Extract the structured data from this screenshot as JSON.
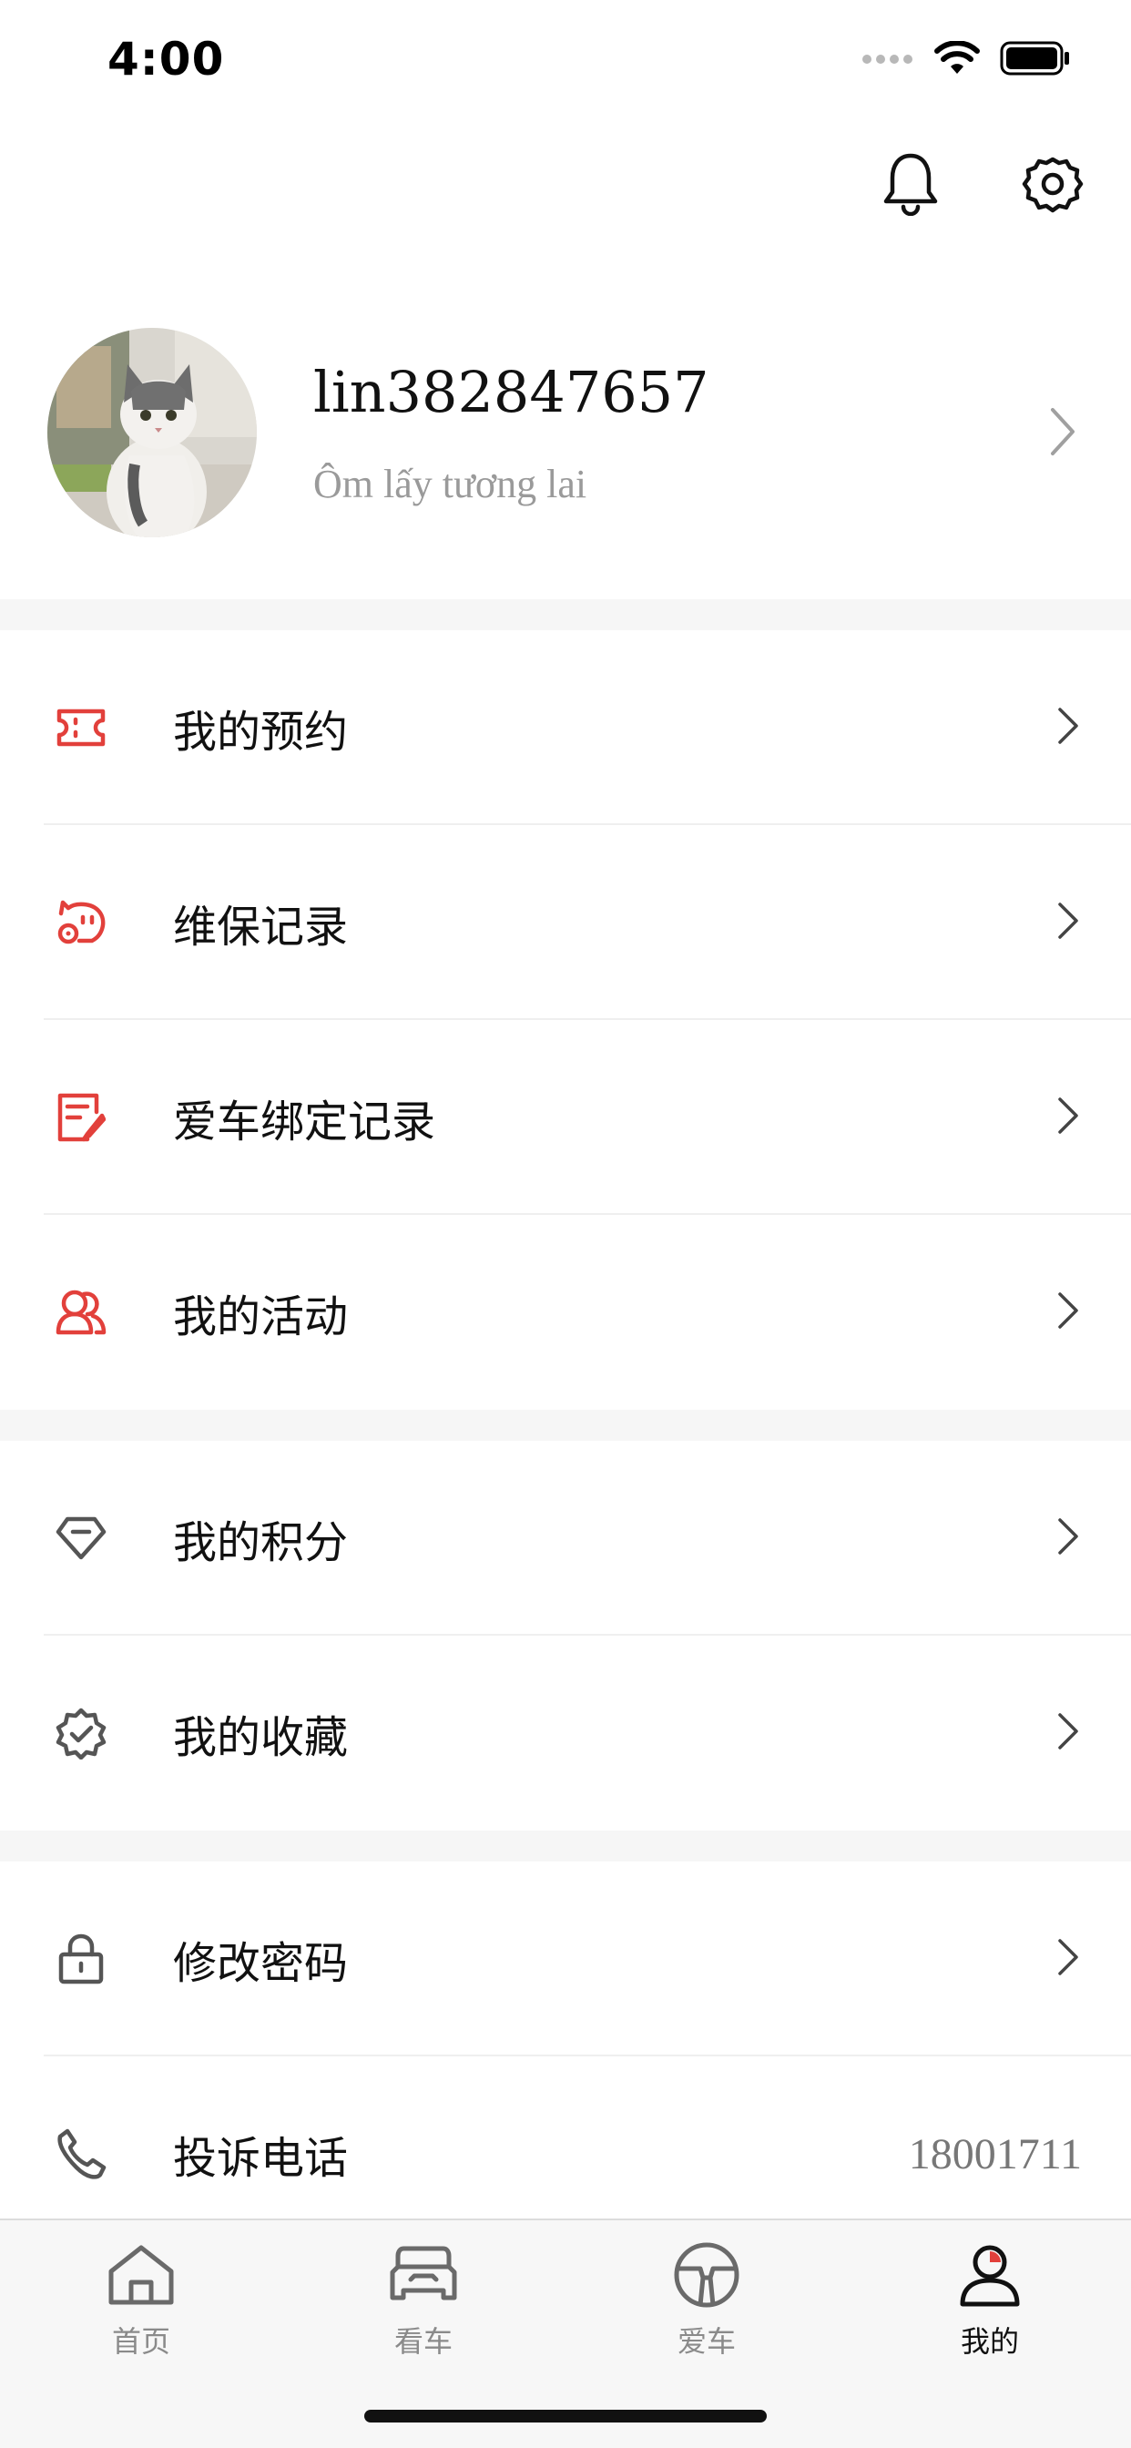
{
  "status_bar": {
    "time": "4:00"
  },
  "header": {
    "icons": [
      "bell-icon",
      "gear-icon"
    ]
  },
  "profile": {
    "username": "lin382847657",
    "signature": "Ôm lấy tương lai"
  },
  "menu_groups": [
    {
      "items": [
        {
          "label": "我的预约",
          "icon": "ticket-icon"
        },
        {
          "label": "维保记录",
          "icon": "maintenance-icon"
        },
        {
          "label": "爱车绑定记录",
          "icon": "edit-document-icon"
        },
        {
          "label": "我的活动",
          "icon": "users-icon"
        }
      ]
    },
    {
      "items": [
        {
          "label": "我的积分",
          "icon": "diamond-icon"
        },
        {
          "label": "我的收藏",
          "icon": "badge-check-icon"
        }
      ]
    },
    {
      "items": [
        {
          "label": "修改密码",
          "icon": "lock-icon"
        },
        {
          "label": "投诉电话",
          "icon": "phone-icon",
          "value": "18001711"
        }
      ]
    }
  ],
  "tab_bar": {
    "tabs": [
      {
        "label": "首页",
        "icon": "home-icon"
      },
      {
        "label": "看车",
        "icon": "car-icon"
      },
      {
        "label": "爱车",
        "icon": "steering-wheel-icon"
      },
      {
        "label": "我的",
        "icon": "profile-icon",
        "active": true
      }
    ]
  },
  "colors": {
    "accent": "#e2403b",
    "icon_gray": "#555555",
    "separator": "#f6f6f6"
  }
}
